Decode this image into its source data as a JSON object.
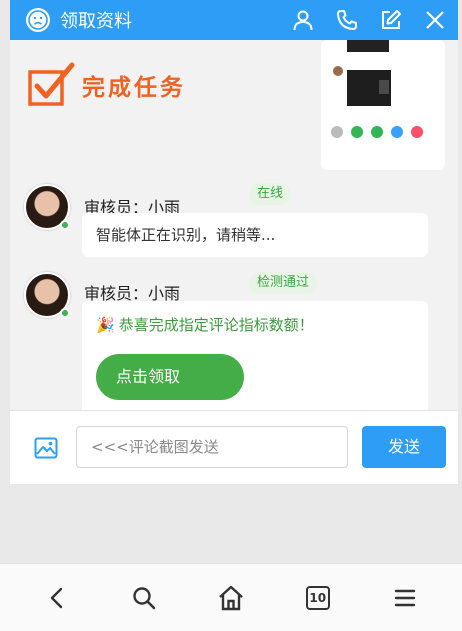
{
  "header": {
    "title": "领取资料",
    "icons": [
      "frown-face-icon",
      "user-icon",
      "phone-icon",
      "edit-icon",
      "close-icon"
    ],
    "bg_color": "#2d9df5"
  },
  "task_badge": {
    "text": "完成任务",
    "color": "#ef6221"
  },
  "messages": [
    {
      "sender": "审核员：小雨",
      "status_tag": "在线",
      "text": "智能体正在识别，请稍等..."
    },
    {
      "sender": "审核员：小雨",
      "status_tag": "检测通过",
      "text": "恭喜完成指定评论指标数额！",
      "emoji": "🎉",
      "button_label": "点击领取"
    }
  ],
  "input": {
    "placeholder": "<<<评论截图发送",
    "send_label": "发送"
  },
  "bottom_nav": {
    "icons": [
      "back-icon",
      "search-icon",
      "home-icon",
      "tabs-icon",
      "menu-icon"
    ],
    "tab_count": "10"
  },
  "colors": {
    "accent": "#2d9df5",
    "success": "#45ad48",
    "tag_bg": "#e7f4e6",
    "tag_text": "#3da441"
  }
}
